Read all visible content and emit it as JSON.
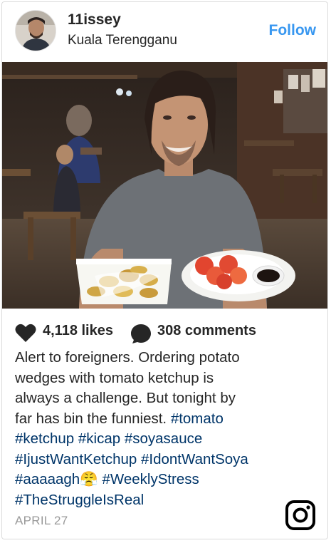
{
  "post": {
    "username": "11issey",
    "location": "Kuala Terengganu",
    "follow_label": "Follow",
    "likes": "4,118 likes",
    "comments": "308 comments",
    "caption": {
      "line1": "Alert to foreigners. Ordering potato",
      "line2": "wedges with tomato ketchup is",
      "line3": "always a challenge. But tonight by",
      "line4_text": "far has bin the funniest.",
      "line4_tag": "#tomato",
      "line5": "#ketchup #kicap #soyasauce",
      "line6": "#IjustWantKetchup #IdontWantSoya",
      "line7_tag1": "#aaaaagh",
      "line7_emoji": "😤",
      "line7_tag2": "#WeeklyStress",
      "line8": "#TheStruggleIsReal"
    },
    "date": "APRIL 27"
  },
  "icons": {
    "heart": "heart-icon",
    "comment": "comment-bubble-icon",
    "brand": "instagram-logo-icon"
  },
  "colors": {
    "follow": "#3897f0",
    "hashtag": "#003569",
    "date": "#999999"
  }
}
